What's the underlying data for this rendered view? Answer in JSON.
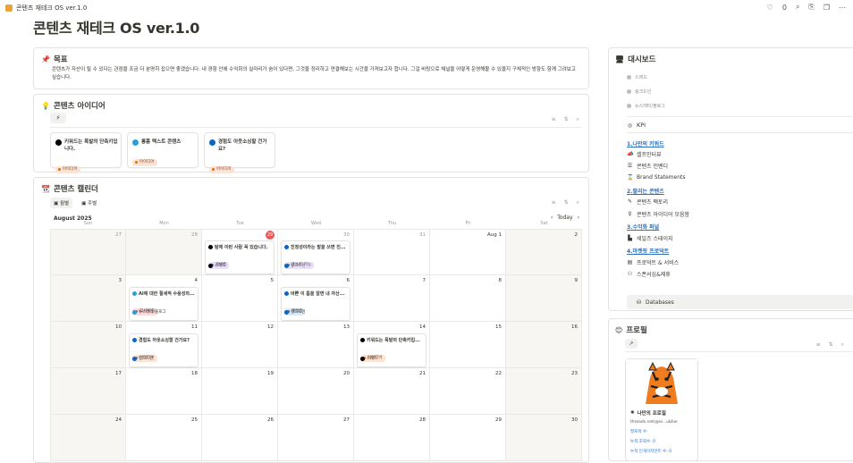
{
  "tab": {
    "title": "콘텐츠 재테크 OS ver.1.0",
    "likes": "0"
  },
  "page": {
    "title": "콘텐츠 재테크 OS ver.1.0"
  },
  "goal": {
    "heading": "목표",
    "text": "콘텐츠가 자산이 될 수 있다는 관점을 조금 더 분명히 잡으면 좋겠습니다. 내 경험 안에 수익화의 실마리가 숨어 있다면, 그것을 정리하고 연결해보는 시간을 가져보고자 합니다. 그걸 바탕으로 채널을 어떻게 운영해볼 수 있을지 구체적인 방향도 함께 그려보고 싶습니다."
  },
  "ideas": {
    "heading": "콘텐츠 아이디어",
    "cards": [
      {
        "title": "키워드는 폭발의 단축키입니다.",
        "tag": "아이디어",
        "icon": "threads-icon",
        "color": "#000000"
      },
      {
        "title": "롱폼 텍스트 콘텐츠",
        "tag": "아이디어",
        "icon": "telegram-icon",
        "color": "#2a9fd6"
      },
      {
        "title": "경험도 아웃소싱할 건가요?",
        "tag": "아이디어",
        "icon": "linkedin-icon",
        "color": "#0a66c2"
      }
    ]
  },
  "calendar": {
    "heading": "콘텐츠 캘린더",
    "view_month": "월별",
    "view_week": "주별",
    "month": "August 2025",
    "today": "Today",
    "dows": [
      "Sun",
      "Mon",
      "Tue",
      "Wed",
      "Thu",
      "Fri",
      "Sat"
    ],
    "weeks": [
      [
        "27",
        "28",
        "29",
        "30",
        "31",
        "Aug 1",
        "2"
      ],
      [
        "3",
        "4",
        "5",
        "6",
        "7",
        "8",
        "9"
      ],
      [
        "10",
        "11",
        "12",
        "13",
        "14",
        "15",
        "16"
      ],
      [
        "17",
        "18",
        "19",
        "20",
        "21",
        "22",
        "23"
      ],
      [
        "24",
        "25",
        "26",
        "27",
        "28",
        "29",
        "30"
      ]
    ],
    "events": [
      {
        "title": "탐에 이런 사람 꼭 있습니다.",
        "tag": "준비중",
        "tagcolor": "purple",
        "channel": "스레드",
        "chcolor": "#000000",
        "week": 0,
        "day": 2
      },
      {
        "title": "진정성이라는 말을 쓰면 진...",
        "tag": "포스트 가능",
        "tagcolor": "purple",
        "channel": "링크드인",
        "chcolor": "#0a66c2",
        "week": 0,
        "day": 3
      },
      {
        "title": "AI에 대한 절세적 수용성의...",
        "tag": "리서치중",
        "tagcolor": "red",
        "channel": "뉴스레터/블로그",
        "chcolor": "#2a9fd6",
        "week": 1,
        "day": 1
      },
      {
        "title": "바쁜 이 틈을 알면 내 자산...",
        "tag": "제작중",
        "tagcolor": "blue",
        "channel": "링크드인",
        "chcolor": "#0a66c2",
        "week": 1,
        "day": 3
      },
      {
        "title": "경험도 아웃소싱할 건가요?",
        "tag": "아이디어",
        "tagcolor": "orange",
        "channel": "링크드인",
        "chcolor": "#0a66c2",
        "week": 2,
        "day": 1
      },
      {
        "title": "키워드는 폭발의 단축키입...",
        "tag": "아이디어",
        "tagcolor": "orange",
        "channel": "스레드",
        "chcolor": "#000000",
        "week": 2,
        "day": 4
      }
    ]
  },
  "dashboard": {
    "heading": "대시보드",
    "channels": [
      "스레드",
      "링크드인",
      "뉴스레터/블로그"
    ],
    "kpi": "KPI",
    "sections": [
      {
        "title": "1.나만의 키워드",
        "items": [
          "셀프인터뷰",
          "콘텐츠 인벤디",
          "Brand Statements"
        ]
      },
      {
        "title": "2.팔리는 콘텐츠",
        "items": [
          "콘텐츠 팩토리",
          "콘텐츠 아이디어 모음함"
        ]
      },
      {
        "title": "3.수익화 퍼널",
        "items": [
          "세일즈 스테이지"
        ]
      },
      {
        "title": "4.마켓핏 프로덕트",
        "items": [
          "프로덕트 & 서비스",
          "스폰서십&제휴"
        ]
      }
    ],
    "databases": "Databases"
  },
  "profile": {
    "heading": "프로필",
    "card_title": "나만의 프로필",
    "url": "threads.net/@ie...ublier",
    "followers": "팔로워 수:",
    "views": "누적 조회수: 0",
    "engage": "누적 인게이지먼트 수: 0"
  }
}
